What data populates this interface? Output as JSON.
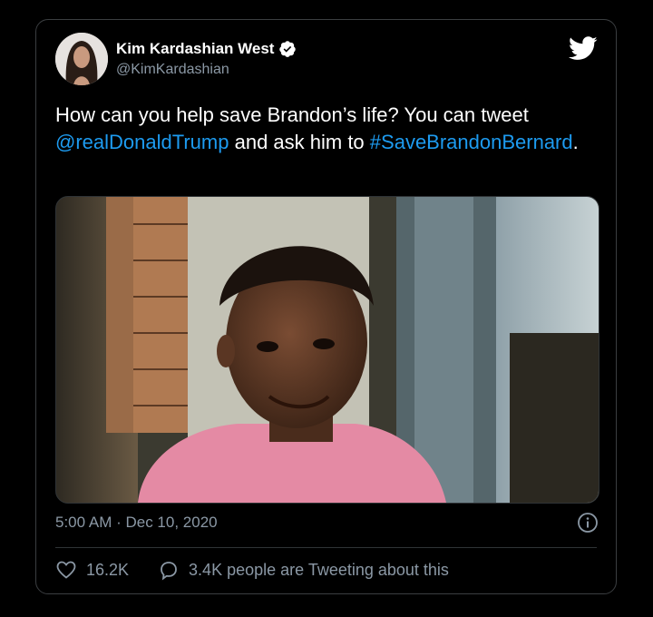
{
  "author": {
    "display_name": "Kim Kardashian West",
    "handle": "@KimKardashian",
    "avatar_icon": "profile-photo",
    "verified_icon": "verified-badge-icon"
  },
  "tweet": {
    "text_part1": "How can you help save Brandon’s life?  You can tweet ",
    "mention": "@realDonaldTrump",
    "text_part2": " and ask him to ",
    "hashtag": "#SaveBrandonBernard",
    "text_part3": "."
  },
  "media": {
    "description_icon": "photo"
  },
  "meta": {
    "timestamp": "5:00 AM · Dec 10, 2020"
  },
  "stats": {
    "likes": "16.2K",
    "conversation": "3.4K people are Tweeting about this"
  },
  "colors": {
    "background": "#000000",
    "text": "#ffffff",
    "secondary": "#8b98a5",
    "link": "#1d9bf0",
    "border": "#3b3e41"
  }
}
